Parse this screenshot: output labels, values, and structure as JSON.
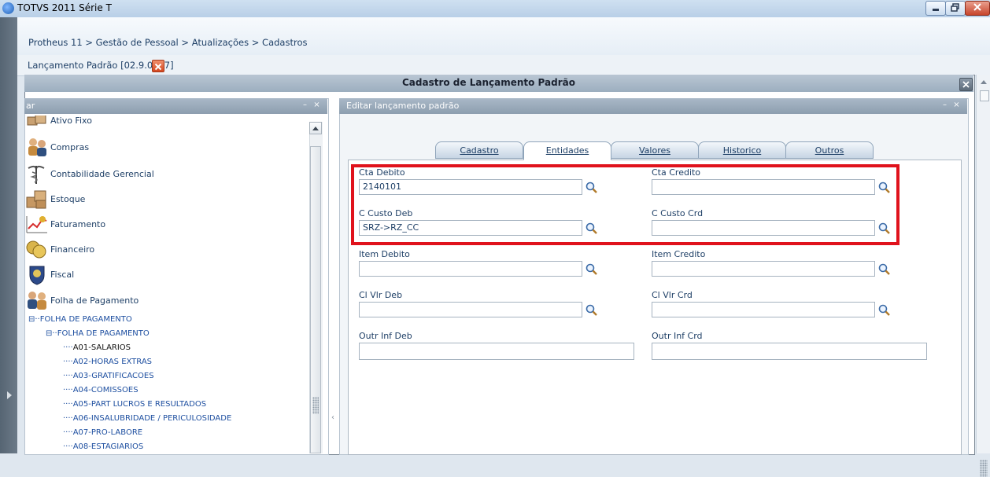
{
  "window": {
    "title": "TOTVS 2011 Série T"
  },
  "breadcrumb": "Protheus 11 > Gestão de Pessoal > Atualizações > Cadastros",
  "doc_tab": {
    "label": "Lançamento Padrão [02.9.0007]"
  },
  "dialog": {
    "title": "Cadastro de Lançamento Padrão"
  },
  "left_panel": {
    "title": "ar",
    "modules": [
      {
        "label": "Ativo Fixo",
        "icon": "boxes-icon"
      },
      {
        "label": "Compras",
        "icon": "people-icon"
      },
      {
        "label": "Contabilidade Gerencial",
        "icon": "caduceus-icon"
      },
      {
        "label": "Estoque",
        "icon": "boxes-icon"
      },
      {
        "label": "Faturamento",
        "icon": "chart-icon"
      },
      {
        "label": "Financeiro",
        "icon": "coins-icon"
      },
      {
        "label": "Fiscal",
        "icon": "crest-icon"
      },
      {
        "label": "Folha de Pagamento",
        "icon": "people-icon"
      }
    ],
    "tree": [
      {
        "label": "FOLHA DE PAGAMENTO",
        "prefix": "⊟··"
      },
      {
        "label": "FOLHA DE PAGAMENTO",
        "prefix": "⊟··"
      },
      {
        "label": "A01-SALARIOS",
        "prefix": "····"
      },
      {
        "label": "A02-HORAS EXTRAS",
        "prefix": "····"
      },
      {
        "label": "A03-GRATIFICACOES",
        "prefix": "····"
      },
      {
        "label": "A04-COMISSOES",
        "prefix": "····"
      },
      {
        "label": "A05-PART LUCROS E RESULTADOS",
        "prefix": "····"
      },
      {
        "label": "A06-INSALUBRIDADE / PERICULOSIDADE",
        "prefix": "····"
      },
      {
        "label": "A07-PRO-LABORE",
        "prefix": "····"
      },
      {
        "label": "A08-ESTAGIARIOS",
        "prefix": "····"
      }
    ]
  },
  "right_panel": {
    "title": "Editar lançamento padrão",
    "tabs": [
      "Cadastro",
      "Entidades",
      "Valores",
      "Historico",
      "Outros"
    ],
    "active_tab": "Entidades",
    "fields": {
      "cta_debito": {
        "label": "Cta Debito",
        "value": "2140101"
      },
      "cta_credito": {
        "label": "Cta Credito",
        "value": ""
      },
      "ccusto_deb": {
        "label": "C Custo Deb",
        "value": "SRZ->RZ_CC"
      },
      "ccusto_crd": {
        "label": "C Custo Crd",
        "value": ""
      },
      "item_debito": {
        "label": "Item Debito",
        "value": ""
      },
      "item_credito": {
        "label": "Item Credito",
        "value": ""
      },
      "cl_vlr_deb": {
        "label": "Cl Vlr Deb",
        "value": ""
      },
      "cl_vlr_crd": {
        "label": "Cl Vlr Crd",
        "value": ""
      },
      "outr_inf_deb": {
        "label": "Outr Inf Deb",
        "value": ""
      },
      "outr_inf_crd": {
        "label": "Outr Inf Crd",
        "value": ""
      }
    }
  },
  "colors": {
    "highlight": "#e0121c",
    "link": "#1e3f66",
    "header": "#9caebf"
  }
}
